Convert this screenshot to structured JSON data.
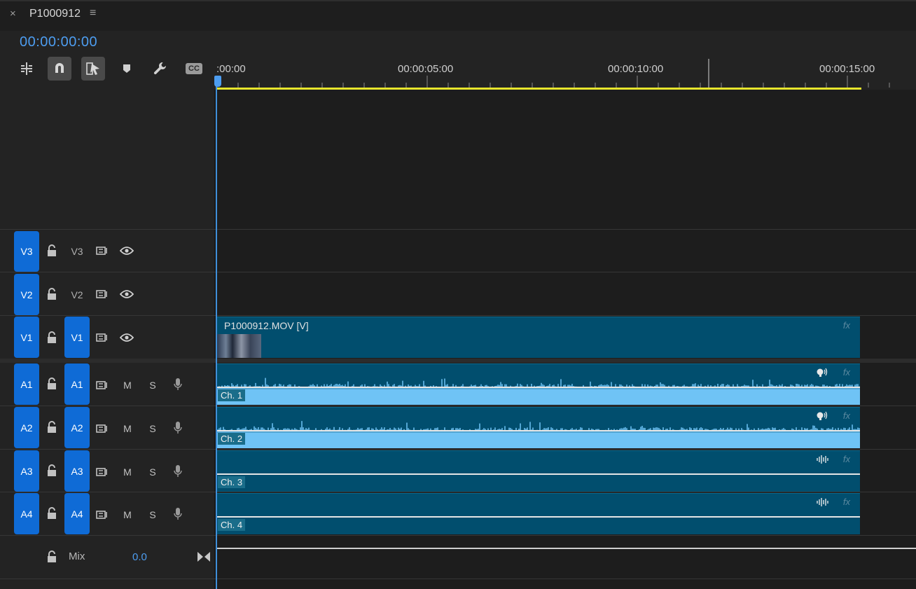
{
  "panel": {
    "close_glyph": "×",
    "sequence_name": "P1000912",
    "menu_glyph": "≡",
    "timecode": "00:00:00:00"
  },
  "toolbar": {
    "tools": [
      {
        "name": "insert-nest-icon",
        "active": false
      },
      {
        "name": "snap-magnet-icon",
        "active": true
      },
      {
        "name": "linked-selection-icon",
        "active": true
      },
      {
        "name": "add-marker-icon",
        "active": false
      },
      {
        "name": "wrench-settings-icon",
        "active": false
      },
      {
        "name": "captions-cc-icon",
        "active": false
      }
    ],
    "cc_label": "CC"
  },
  "ruler": {
    "labels": [
      ":00:00",
      "00:00:05:00",
      "00:00:10:00",
      "00:00:15:00"
    ]
  },
  "video_tracks": [
    {
      "source": "V3",
      "target": "V3",
      "target_active": false
    },
    {
      "source": "V2",
      "target": "V2",
      "target_active": false
    },
    {
      "source": "V1",
      "target": "V1",
      "target_active": true
    }
  ],
  "audio_tracks": [
    {
      "source": "A1",
      "target": "A1",
      "mute": "M",
      "solo": "S",
      "channel": "Ch. 1",
      "has_waveform": true
    },
    {
      "source": "A2",
      "target": "A2",
      "mute": "M",
      "solo": "S",
      "channel": "Ch. 2",
      "has_waveform": true
    },
    {
      "source": "A3",
      "target": "A3",
      "mute": "M",
      "solo": "S",
      "channel": "Ch. 3",
      "has_waveform": false
    },
    {
      "source": "A4",
      "target": "A4",
      "mute": "M",
      "solo": "S",
      "channel": "Ch. 4",
      "has_waveform": false
    }
  ],
  "video_clip": {
    "name": "P1000912.MOV [V]",
    "fx": "fx"
  },
  "audio_fx": "fx",
  "mix": {
    "label": "Mix",
    "value": "0.0"
  },
  "colors": {
    "accent": "#0f6bd6",
    "timecode": "#4d9df0",
    "clip": "#014e6e",
    "waveform": "#6fc3f5",
    "in_out": "#e7e52c"
  }
}
